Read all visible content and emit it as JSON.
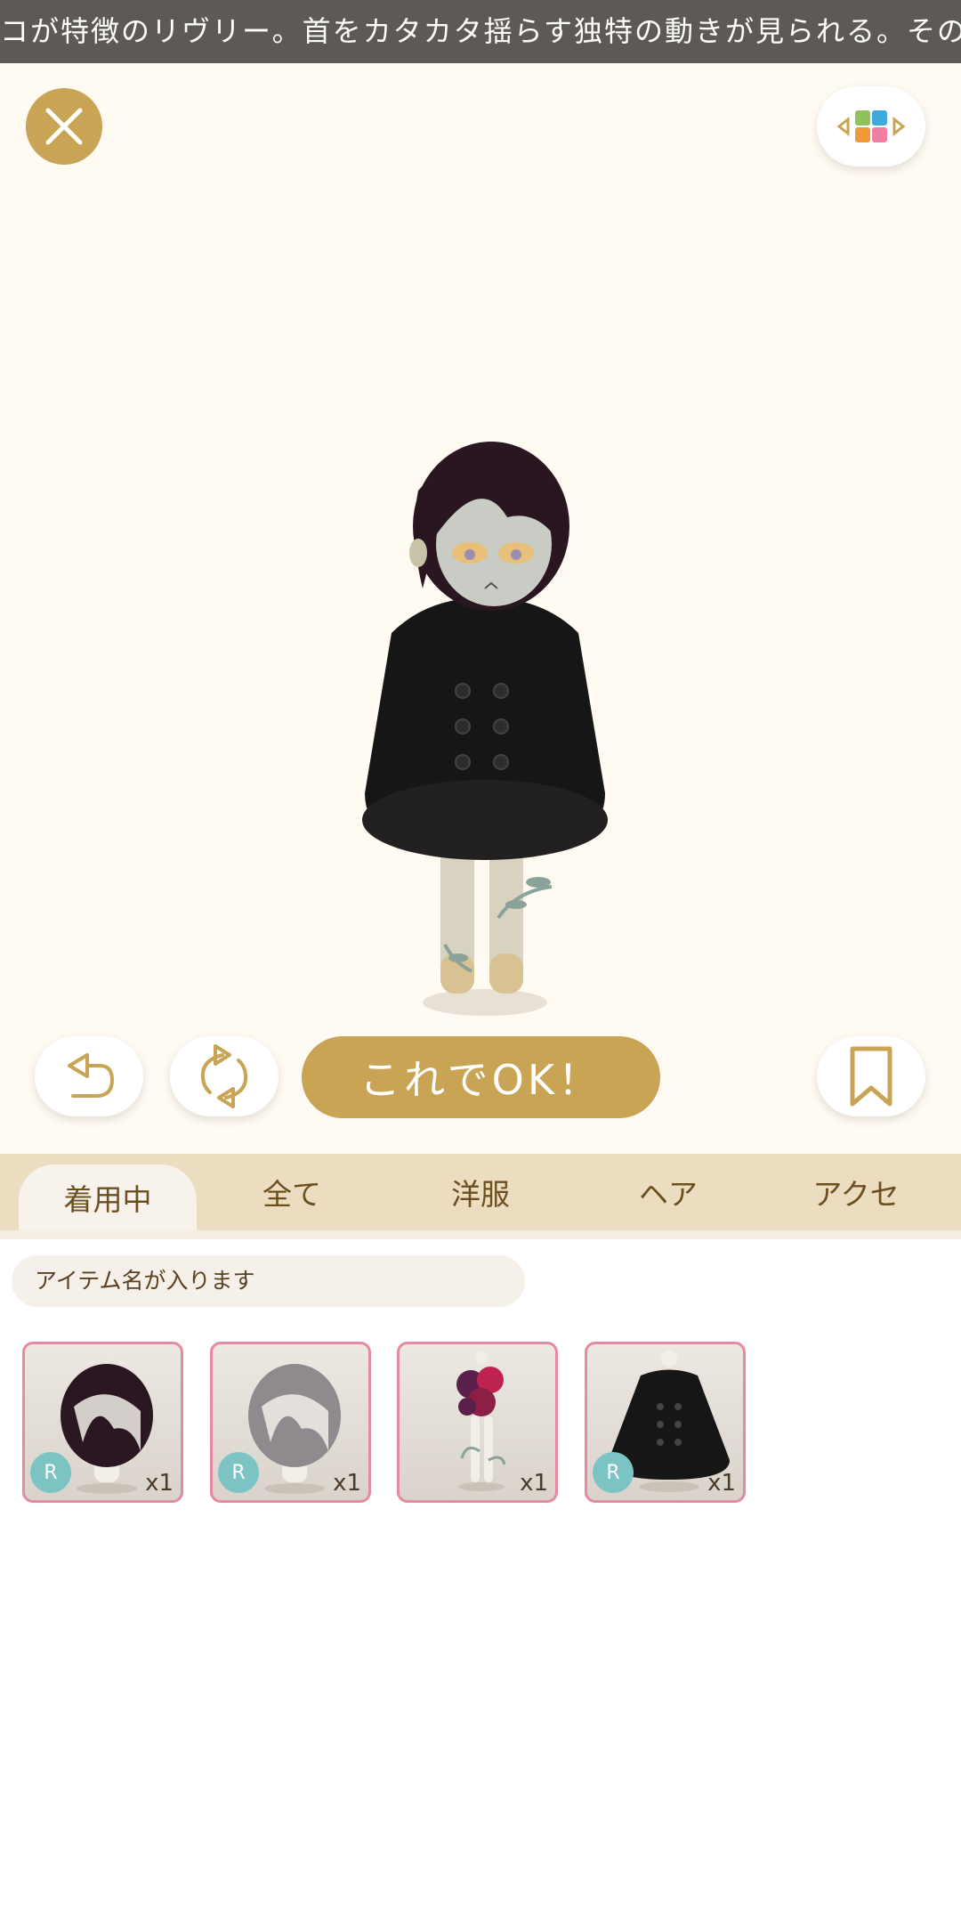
{
  "ticker": {
    "text": "コが特徴のリヴリー。首をカタカタ揺らす独特の動きが見られる。その"
  },
  "header": {
    "close_icon": "close-icon",
    "view_icon": "grid-arrows-icon"
  },
  "actions": {
    "undo_icon": "undo-icon",
    "rotate_icon": "rotate-icon",
    "ok_label": "これでOK！",
    "bookmark_icon": "bookmark-icon"
  },
  "tabs": [
    {
      "label": "着用中",
      "active": true
    },
    {
      "label": "全て",
      "active": false
    },
    {
      "label": "洋服",
      "active": false
    },
    {
      "label": "ヘア",
      "active": false
    },
    {
      "label": "アクセ",
      "active": false
    }
  ],
  "item_name_field": {
    "placeholder": "アイテム名が入ります"
  },
  "items": [
    {
      "rarity": "R",
      "qty": "x1",
      "kind": "dark-hair"
    },
    {
      "rarity": "R",
      "qty": "x1",
      "kind": "gray-hair"
    },
    {
      "rarity": "",
      "qty": "x1",
      "kind": "flower-body"
    },
    {
      "rarity": "R",
      "qty": "x1",
      "kind": "black-coat"
    }
  ],
  "colors": {
    "accent": "#c8a454",
    "tab_bar": "#ecdcc0",
    "item_border": "#e58aa0",
    "rarity_badge": "#7cc4c4"
  }
}
